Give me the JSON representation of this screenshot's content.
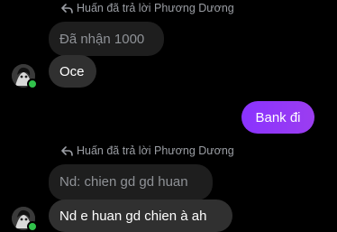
{
  "thread": [
    {
      "reply_header": "Huấn đã trả lời Phương Dương",
      "quoted_text": "Đã nhận 1000",
      "message": "Oce",
      "sender_avatar": "contact-avatar",
      "online": true
    },
    {
      "message": "Bank đi",
      "outgoing": true
    },
    {
      "reply_header": "Huấn đã trả lời Phương Dương",
      "quoted_text": "Nd: chien gd gd huan",
      "message": "Nd e huan gd chien à ah",
      "sender_avatar": "contact-avatar",
      "online": true
    }
  ],
  "icons": {
    "reply": "reply-arrow-icon"
  },
  "colors": {
    "background": "#000000",
    "incoming_bubble": "#303030",
    "quoted_bubble": "#1e1e1e",
    "outgoing_bubble": "#8a33ff",
    "presence": "#31c24b"
  }
}
